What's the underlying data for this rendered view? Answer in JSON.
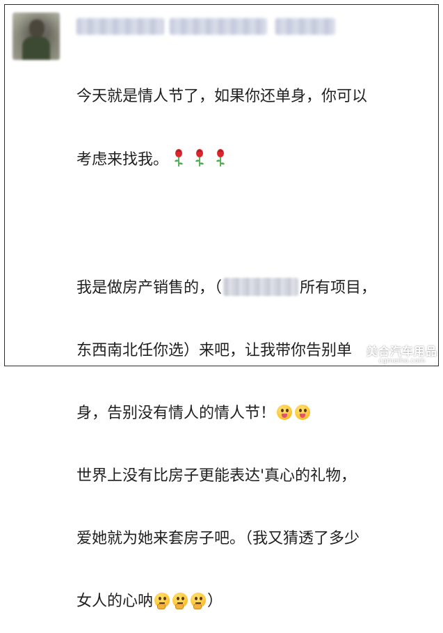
{
  "post1": {
    "line1": "今天就是情人节了，如果你还单身，你可以",
    "line2": "考虑来找我。"
  },
  "post2": {
    "line1_a": "我是做房产销售的，（",
    "line1_b": "所有项目，",
    "line2": "东西南北任你选）来吧，让我带你告别单",
    "line3": "身，告别没有情人的情人节！",
    "line4": "世界上没有比房子更能表达'真心的礼物，",
    "line5": "爱她就为她来套房子吧。（我又猜透了多少",
    "line6": "女人的心呐"
  },
  "watermark": {
    "title": "美合汽车用品",
    "url": "cgmeiho.com"
  },
  "icons": {
    "rose": "rose-icon",
    "tongue_wink": "tongue-wink-emoji-icon",
    "thinking": "thinking-emoji-icon"
  }
}
